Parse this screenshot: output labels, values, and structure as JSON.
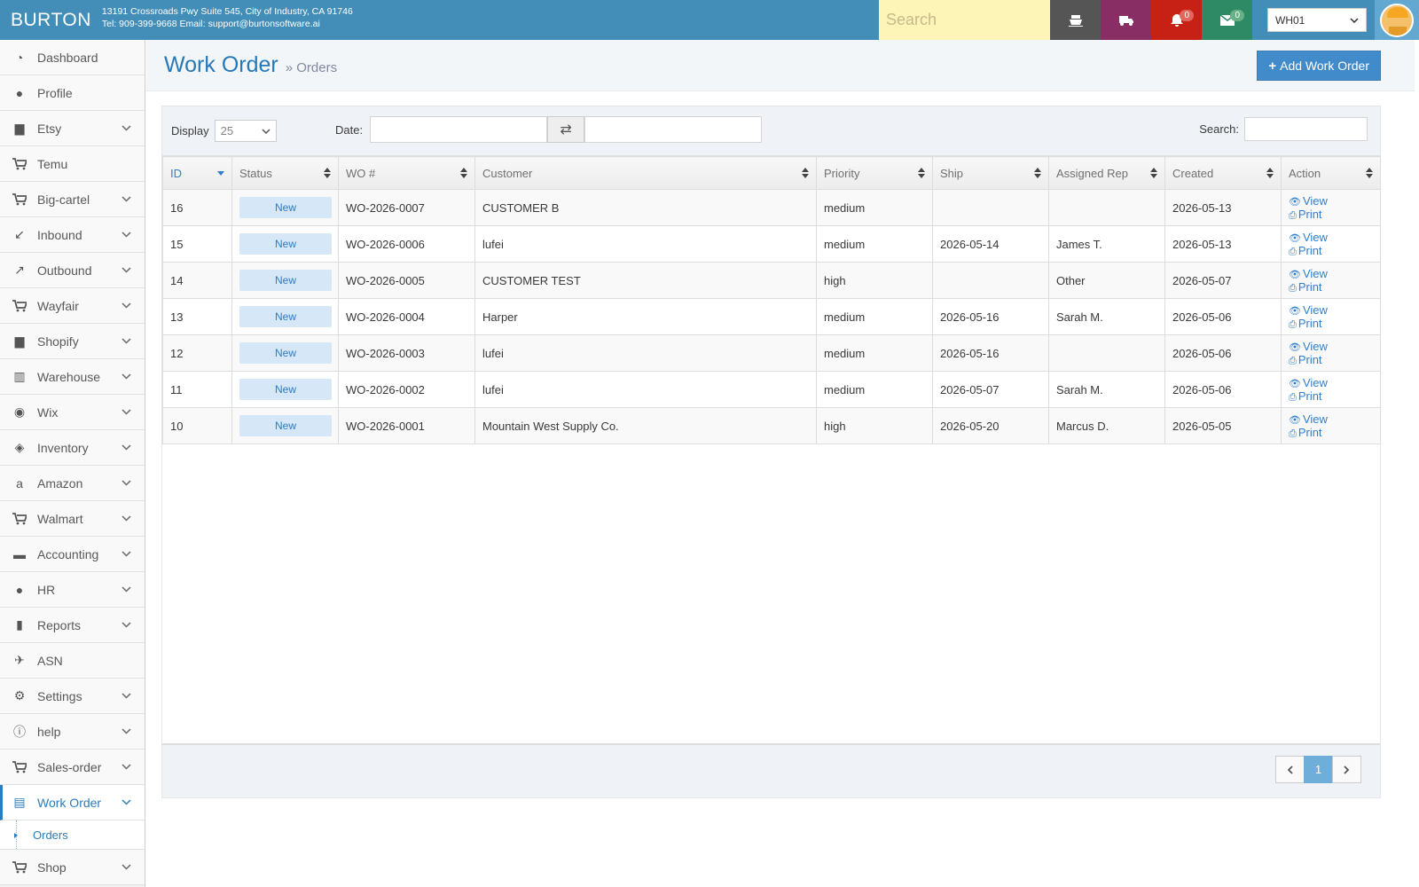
{
  "brand": "BURTON",
  "company": {
    "address": "13191 Crossroads Pwy Suite 545, City of Industry, CA 91746",
    "contact": "Tel: 909-399-9668 Email: support@burtonsoftware.ai"
  },
  "topnav": {
    "search_placeholder": "Search",
    "notifications_count": "0",
    "messages_count": "0",
    "warehouse": "WH01"
  },
  "sidebar": {
    "items": [
      {
        "label": "Dashboard",
        "icon": "dashboard-icon",
        "expandable": false
      },
      {
        "label": "Profile",
        "icon": "user-icon",
        "expandable": false
      },
      {
        "label": "Etsy",
        "icon": "shopping-bag-icon",
        "expandable": true
      },
      {
        "label": "Temu",
        "icon": "cart-icon",
        "expandable": false
      },
      {
        "label": "Big-cartel",
        "icon": "cart-icon",
        "expandable": true
      },
      {
        "label": "Inbound",
        "icon": "compress-icon",
        "expandable": true
      },
      {
        "label": "Outbound",
        "icon": "expand-icon",
        "expandable": true
      },
      {
        "label": "Wayfair",
        "icon": "cart-icon",
        "expandable": true
      },
      {
        "label": "Shopify",
        "icon": "shopping-bag-icon",
        "expandable": true
      },
      {
        "label": "Warehouse",
        "icon": "barcode-icon",
        "expandable": true
      },
      {
        "label": "Wix",
        "icon": "globe-icon",
        "expandable": true
      },
      {
        "label": "Inventory",
        "icon": "cube-icon",
        "expandable": true
      },
      {
        "label": "Amazon",
        "icon": "amazon-icon",
        "expandable": true
      },
      {
        "label": "Walmart",
        "icon": "cart-icon",
        "expandable": true
      },
      {
        "label": "Accounting",
        "icon": "briefcase-icon",
        "expandable": true
      },
      {
        "label": "HR",
        "icon": "user-icon",
        "expandable": true
      },
      {
        "label": "Reports",
        "icon": "file-icon",
        "expandable": true
      },
      {
        "label": "ASN",
        "icon": "plane-icon",
        "expandable": false
      },
      {
        "label": "Settings",
        "icon": "gear-icon",
        "expandable": true
      },
      {
        "label": "help",
        "icon": "info-icon",
        "expandable": true
      },
      {
        "label": "Sales-order",
        "icon": "cart-icon",
        "expandable": true
      },
      {
        "label": "Work Order",
        "icon": "file-text-icon",
        "expandable": true,
        "active": true
      },
      {
        "label": "Shop",
        "icon": "cart-icon",
        "expandable": true
      }
    ],
    "submenu": {
      "label": "Orders"
    }
  },
  "page": {
    "title": "Work Order",
    "breadcrumb_sep": "»",
    "subtitle": "Orders",
    "add_button": "Add Work Order"
  },
  "filters": {
    "display_label": "Display",
    "display_value": "25",
    "date_label": "Date:",
    "search_label": "Search:"
  },
  "table": {
    "columns": [
      "ID",
      "Status",
      "WO #",
      "Customer",
      "Priority",
      "Ship",
      "Assigned Rep",
      "Created",
      "Action"
    ],
    "rows": [
      {
        "id": "16",
        "status": "New",
        "wo": "WO-2026-0007",
        "customer": "CUSTOMER B",
        "priority": "medium",
        "ship": "",
        "rep": "",
        "created": "2026-05-13"
      },
      {
        "id": "15",
        "status": "New",
        "wo": "WO-2026-0006",
        "customer": "lufei",
        "priority": "medium",
        "ship": "2026-05-14",
        "rep": "James T.",
        "created": "2026-05-13"
      },
      {
        "id": "14",
        "status": "New",
        "wo": "WO-2026-0005",
        "customer": "CUSTOMER TEST",
        "priority": "high",
        "ship": "",
        "rep": "Other",
        "created": "2026-05-07"
      },
      {
        "id": "13",
        "status": "New",
        "wo": "WO-2026-0004",
        "customer": "Harper",
        "priority": "medium",
        "ship": "2026-05-16",
        "rep": "Sarah M.",
        "created": "2026-05-06"
      },
      {
        "id": "12",
        "status": "New",
        "wo": "WO-2026-0003",
        "customer": "lufei",
        "priority": "medium",
        "ship": "2026-05-16",
        "rep": "",
        "created": "2026-05-06"
      },
      {
        "id": "11",
        "status": "New",
        "wo": "WO-2026-0002",
        "customer": "lufei",
        "priority": "medium",
        "ship": "2026-05-07",
        "rep": "Sarah M.",
        "created": "2026-05-06"
      },
      {
        "id": "10",
        "status": "New",
        "wo": "WO-2026-0001",
        "customer": "Mountain West Supply Co.",
        "priority": "high",
        "ship": "2026-05-20",
        "rep": "Marcus D.",
        "created": "2026-05-05"
      }
    ],
    "action_view": "View",
    "action_print": "Print"
  },
  "pagination": {
    "current": "1"
  },
  "colors": {
    "accent": "#438eb9",
    "link": "#307ecc",
    "badge_bg": "#d6e7f8"
  }
}
